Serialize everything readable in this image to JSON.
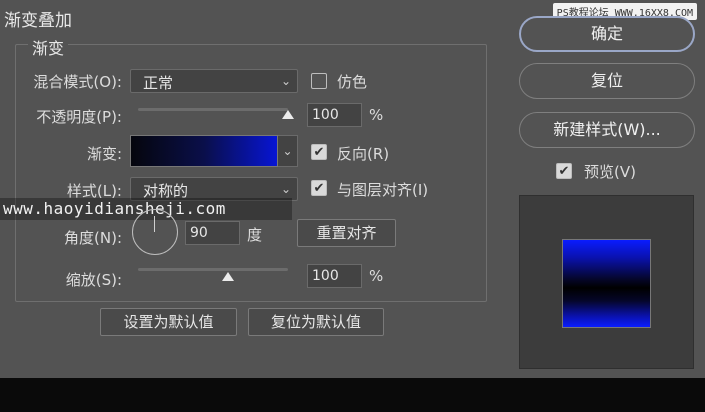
{
  "dialog": {
    "title": "渐变叠加"
  },
  "watermark_top": "PS教程论坛 WWW.16XX8.COM",
  "watermark_mid": "www.haoyidiansheji.com",
  "group": {
    "title": "渐变",
    "blend_mode": {
      "label": "混合模式(O):",
      "value": "正常"
    },
    "dither": {
      "label": "仿色",
      "checked": false
    },
    "opacity": {
      "label": "不透明度(P):",
      "value": "100",
      "unit": "%",
      "level": 1.0
    },
    "gradient": {
      "label": "渐变:",
      "colors": [
        "#05060d",
        "#0a0f4a",
        "#0715d4"
      ]
    },
    "reverse": {
      "label": "反向(R)",
      "checked": true
    },
    "style": {
      "label": "样式(L):",
      "value": "对称的"
    },
    "align_layer": {
      "label": "与图层对齐(I)",
      "checked": true
    },
    "angle": {
      "label": "角度(N):",
      "value": "90",
      "unit": "度"
    },
    "reset_align": "重置对齐",
    "scale": {
      "label": "缩放(S):",
      "value": "100",
      "unit": "%",
      "level": 0.6
    },
    "set_default": "设置为默认值",
    "reset_default": "复位为默认值"
  },
  "right": {
    "ok": "确定",
    "reset": "复位",
    "new_style": "新建样式(W)...",
    "preview": {
      "label": "预览(V)",
      "checked": true
    }
  },
  "check_glyph": "✔",
  "caret_glyph": "⌄"
}
